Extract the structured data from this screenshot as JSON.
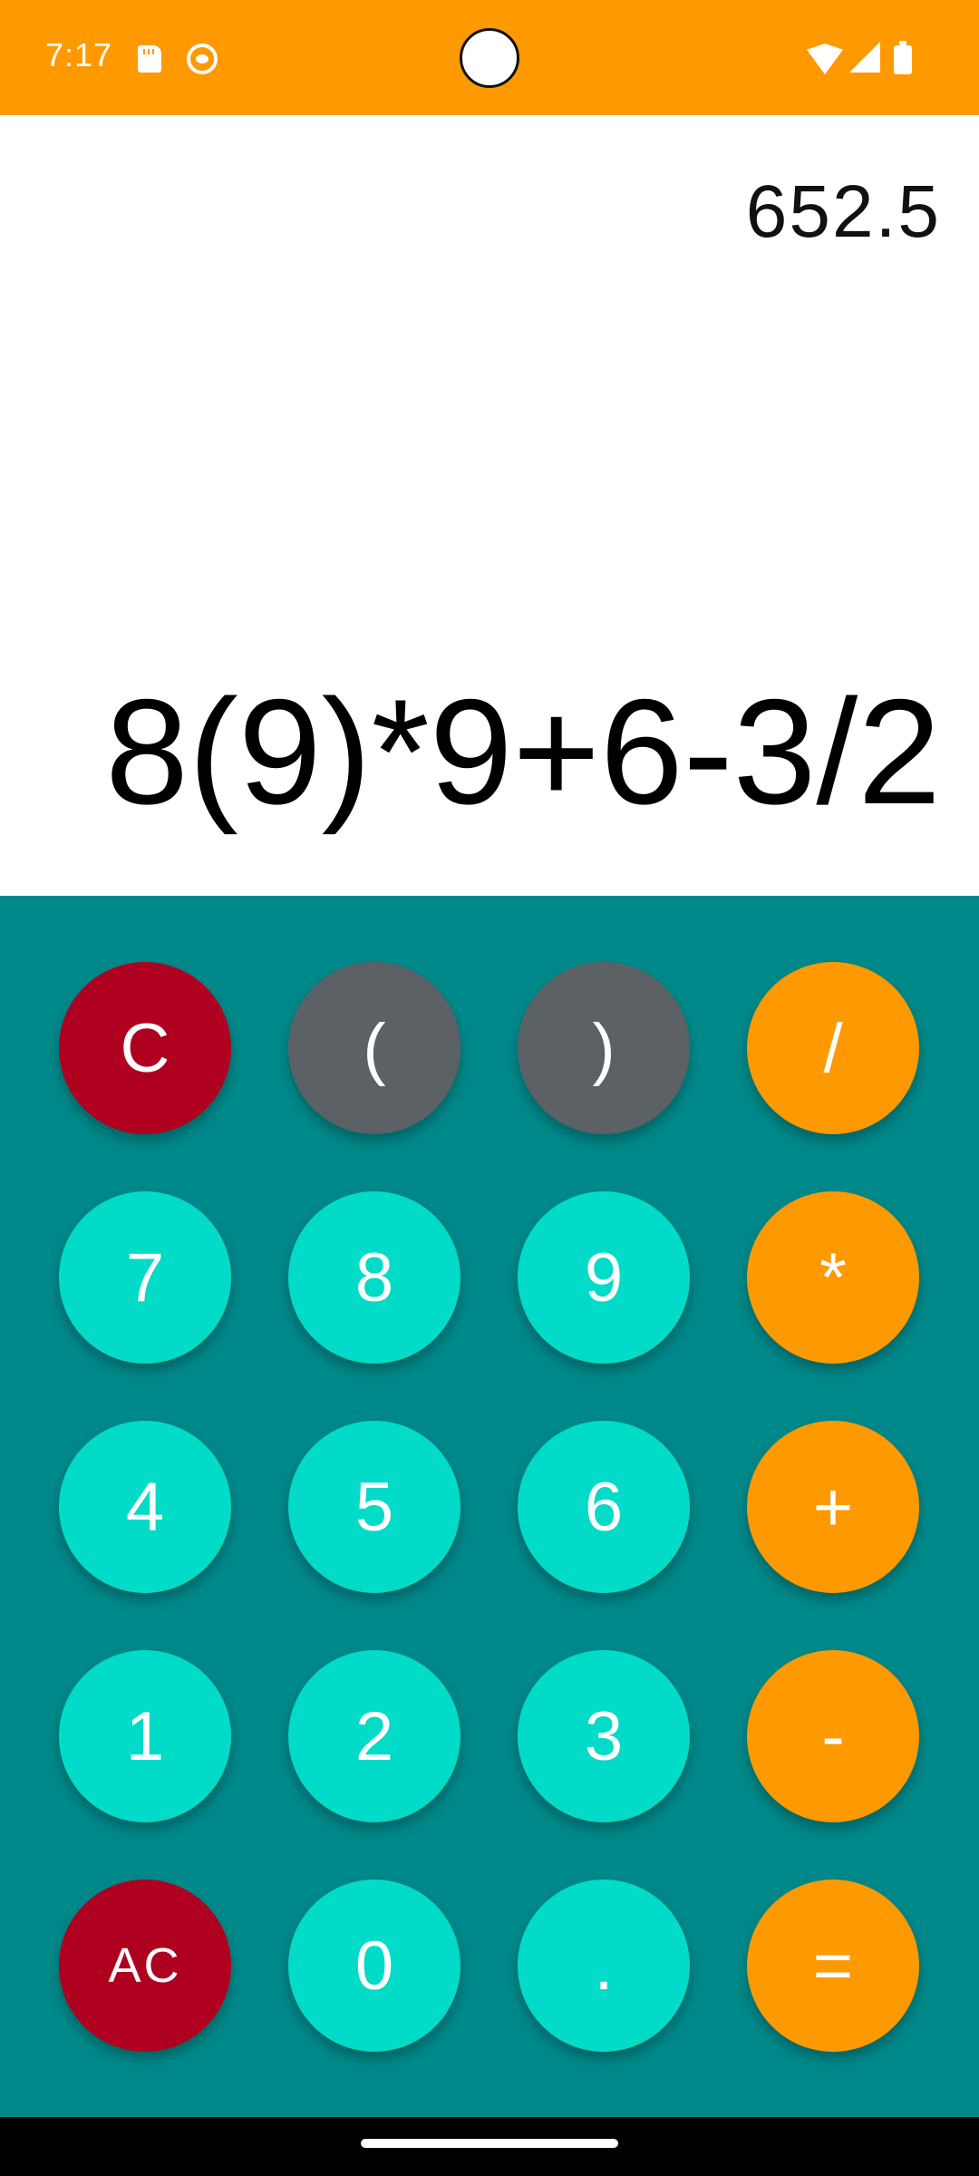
{
  "status_bar": {
    "time": "7:17",
    "left_icons": [
      "sd-card-icon",
      "cat-icon"
    ],
    "right_icons": [
      "wifi-icon",
      "signal-icon",
      "battery-icon"
    ],
    "color": "#ff9900"
  },
  "display": {
    "result": "652.5",
    "expression": "8(9)*9+6-3/2"
  },
  "keypad": {
    "rows": [
      [
        "C",
        "(",
        ")",
        "/"
      ],
      [
        "7",
        "8",
        "9",
        "*"
      ],
      [
        "4",
        "5",
        "6",
        "+"
      ],
      [
        "1",
        "2",
        "3",
        "-"
      ],
      [
        "AC",
        "0",
        ".",
        "="
      ]
    ]
  },
  "colors": {
    "keypad_background": "#00898a",
    "digit_key": "#02dbc7",
    "operator_key": "#ff9900",
    "clear_key": "#b00020",
    "paren_key": "#5b6164"
  }
}
